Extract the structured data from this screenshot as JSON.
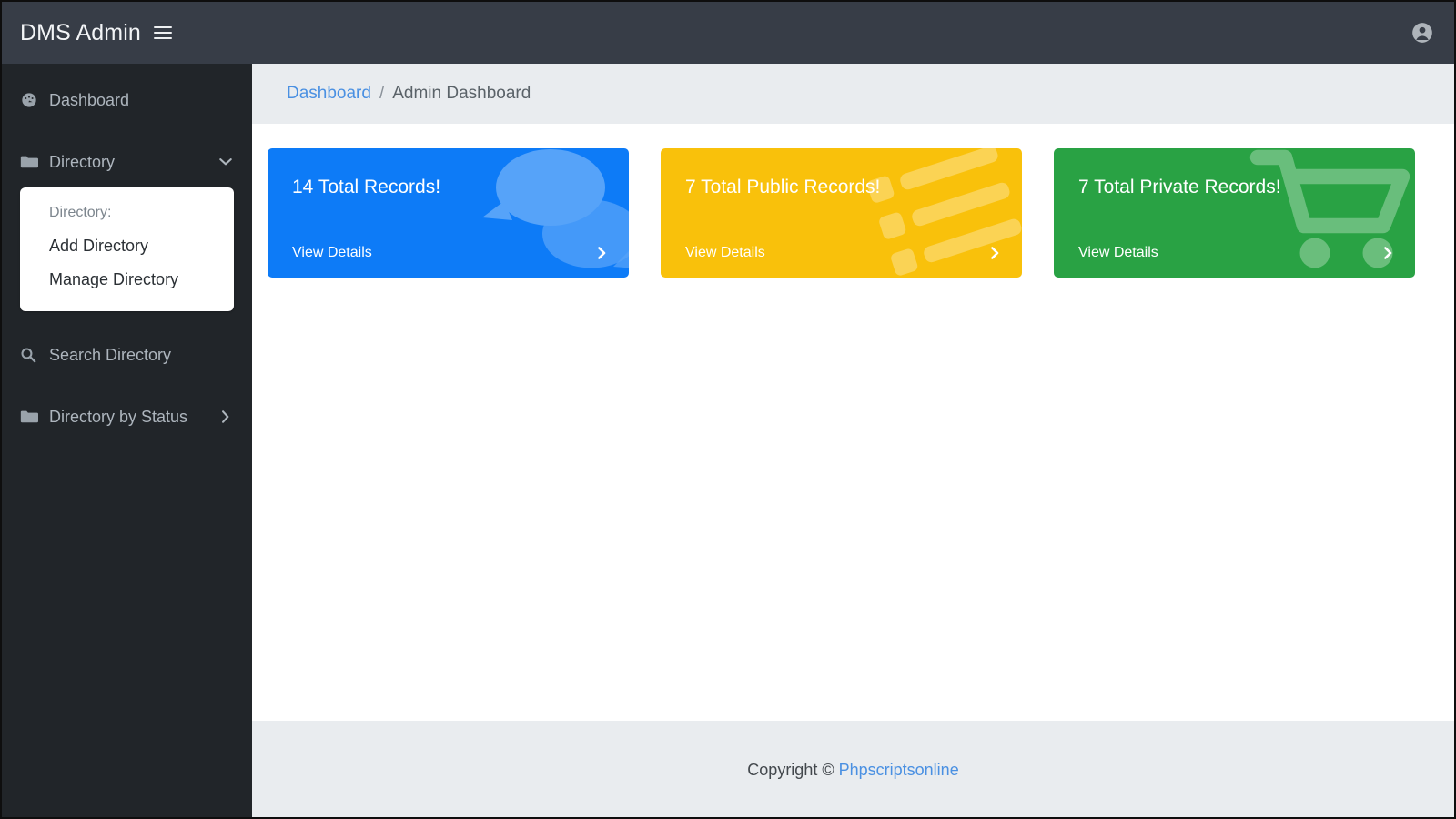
{
  "navbar": {
    "brand": "DMS Admin",
    "menu_toggle_icon": "hamburger-icon",
    "user_icon": "user-circle-icon"
  },
  "sidebar": {
    "items": [
      {
        "label": "Dashboard",
        "icon": "tachometer-icon",
        "chevron": ""
      },
      {
        "label": "Directory",
        "icon": "folder-icon",
        "chevron": "chevron-down-icon"
      },
      {
        "label": "Search Directory",
        "icon": "search-icon",
        "chevron": ""
      },
      {
        "label": "Directory by Status",
        "icon": "folder-icon",
        "chevron": "chevron-right-icon"
      }
    ],
    "directory_collapse": {
      "header": "Directory:",
      "links": [
        "Add Directory",
        "Manage Directory"
      ]
    }
  },
  "breadcrumb": {
    "link": "Dashboard",
    "separator": "/",
    "current": "Admin Dashboard"
  },
  "cards": [
    {
      "title": "14 Total Records!",
      "footer_label": "View Details",
      "color": "#0d7bf7",
      "art_icon": "comments-icon",
      "chevron": "chevron-right-icon"
    },
    {
      "title": "7 Total Public Records!",
      "footer_label": "View Details",
      "color": "#f9c10b",
      "art_icon": "list-tasks-icon",
      "chevron": "chevron-right-icon"
    },
    {
      "title": "7 Total Private Records!",
      "footer_label": "View Details",
      "color": "#29a244",
      "art_icon": "shopping-cart-icon",
      "chevron": "chevron-right-icon"
    }
  ],
  "footer": {
    "text": "Copyright ©",
    "link": "Phpscriptsonline"
  }
}
